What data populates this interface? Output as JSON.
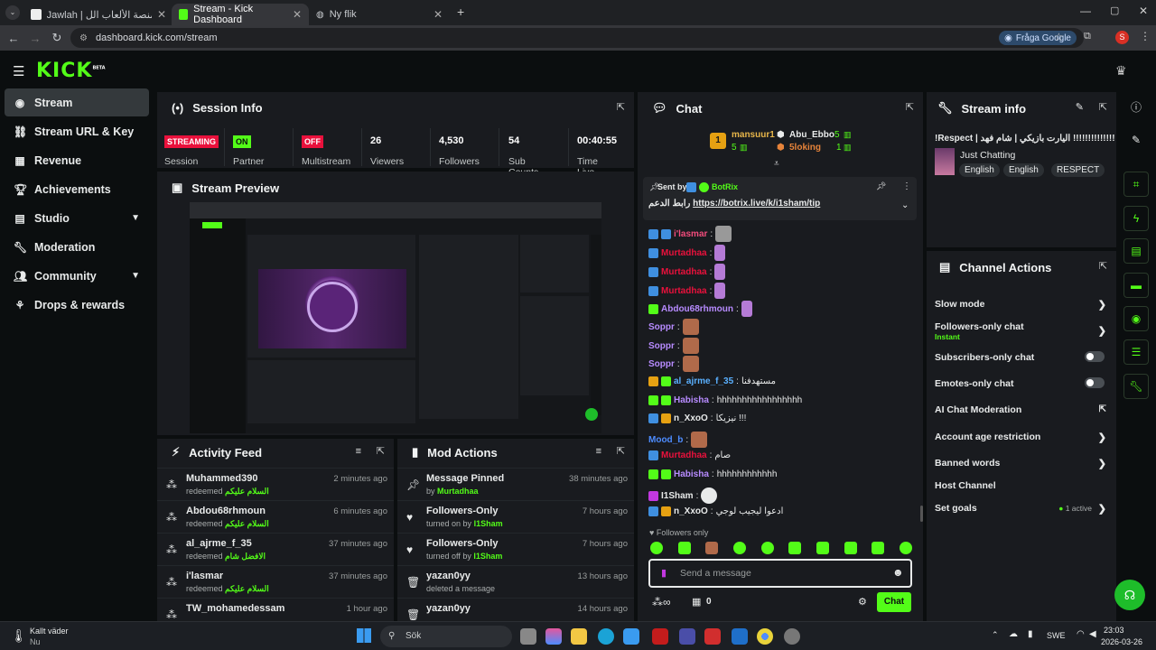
{
  "browser": {
    "tabs": [
      {
        "label": "Jawlah | جولة - منصة الألعاب الل"
      },
      {
        "label": "Stream - Kick Dashboard"
      },
      {
        "label": "Ny flik"
      }
    ],
    "url": "dashboard.kick.com/stream",
    "fraga_label": "Fråga Google",
    "profile_letter": "S"
  },
  "header": {
    "logo": "KICK",
    "beta": "BETA"
  },
  "sidebar": {
    "items": [
      {
        "label": "Stream",
        "icon": "stream-icon"
      },
      {
        "label": "Stream URL & Key",
        "icon": "link-icon"
      },
      {
        "label": "Revenue",
        "icon": "revenue-icon"
      },
      {
        "label": "Achievements",
        "icon": "trophy-icon"
      },
      {
        "label": "Studio",
        "icon": "studio-icon"
      },
      {
        "label": "Moderation",
        "icon": "wrench-icon"
      },
      {
        "label": "Community",
        "icon": "community-icon"
      },
      {
        "label": "Drops & rewards",
        "icon": "drops-icon"
      }
    ]
  },
  "session": {
    "title": "Session Info",
    "stats": [
      {
        "badge": "STREAMING",
        "label": "Session",
        "color": "#e9113c"
      },
      {
        "badge": "ON",
        "label": "Partner",
        "color": "#53fc18"
      },
      {
        "badge": "OFF",
        "label": "Multistream",
        "color": "#e9113c"
      },
      {
        "value": "26",
        "label": "Viewers"
      },
      {
        "value": "4,530",
        "label": "Followers"
      },
      {
        "value": "54",
        "label": "Sub Counts"
      },
      {
        "value": "00:40:55",
        "label": "Time Live"
      }
    ]
  },
  "preview": {
    "title": "Stream Preview"
  },
  "activity": {
    "title": "Activity Feed",
    "rows": [
      {
        "name": "Muhammed390",
        "sub": "redeemed",
        "reward": "السلام عليكم",
        "time": "2 minutes ago"
      },
      {
        "name": "Abdou68rhmoun",
        "sub": "redeemed",
        "reward": "السلام عليكم",
        "time": "6 minutes ago"
      },
      {
        "name": "al_ajrme_f_35",
        "sub": "redeemed",
        "reward": "الافضل شام",
        "time": "37 minutes ago"
      },
      {
        "name": "i'lasmar",
        "sub": "redeemed",
        "reward": "السلام عليكم",
        "time": "37 minutes ago"
      },
      {
        "name": "TW_mohamedessam",
        "sub": "",
        "reward": "",
        "time": "1 hour ago"
      }
    ]
  },
  "mod": {
    "title": "Mod Actions",
    "rows": [
      {
        "name": "Message Pinned",
        "sub": "by",
        "who": "Murtadhaa",
        "time": "38 minutes ago"
      },
      {
        "name": "Followers-Only",
        "sub": "turned on by",
        "who": "I1Sham",
        "time": "7 hours ago"
      },
      {
        "name": "Followers-Only",
        "sub": "turned off by",
        "who": "I1Sham",
        "time": "7 hours ago"
      },
      {
        "name": "yazan0yy",
        "sub": "deleted a message",
        "who": "",
        "time": "13 hours ago"
      },
      {
        "name": "yazan0yy",
        "sub": "",
        "who": "",
        "time": "14 hours ago"
      }
    ]
  },
  "chat": {
    "title": "Chat",
    "gifters": [
      {
        "rank": "1",
        "name": "mansuur1",
        "count": "5"
      },
      {
        "name": "Abu_Ebbo",
        "count": "5"
      },
      {
        "name": "5loking",
        "count": "1"
      }
    ],
    "pinned": {
      "sent_by": "Sent by",
      "bot": "BotRix",
      "text": "رابط الدعم",
      "link": "https://botrix.live/k/i1sham/tip"
    },
    "messages": [
      {
        "user": "i'lasmar",
        "color": "#f24c7c",
        "text": ""
      },
      {
        "user": "Murtadhaa",
        "color": "#e9113c",
        "text": ""
      },
      {
        "user": "Murtadhaa",
        "color": "#e9113c",
        "text": ""
      },
      {
        "user": "Murtadhaa",
        "color": "#e9113c",
        "text": ""
      },
      {
        "user": "Abdou68rhmoun",
        "color": "#b78bff",
        "text": ""
      },
      {
        "user": "Soppr",
        "color": "#b78bff",
        "text": ""
      },
      {
        "user": "Soppr",
        "color": "#b78bff",
        "text": ""
      },
      {
        "user": "Soppr",
        "color": "#b78bff",
        "text": ""
      },
      {
        "user": "al_ajrme_f_35",
        "color": "#5ab0ff",
        "text": "مستهدفنا"
      },
      {
        "user": "Habisha",
        "color": "#b78bff",
        "text": "hhhhhhhhhhhhhhhhh"
      },
      {
        "user": "n_XxoO",
        "color": "#e8eaea",
        "text": "نيزيكا !!!"
      },
      {
        "user": "Mood_b",
        "color": "#4d8cff",
        "text": ""
      },
      {
        "user": "Murtadhaa",
        "color": "#e9113c",
        "text": "صام"
      },
      {
        "user": "Habisha",
        "color": "#b78bff",
        "text": "hhhhhhhhhhhh"
      },
      {
        "user": "I1Sham",
        "color": "#e8eaea",
        "text": ""
      },
      {
        "user": "n_XxoO",
        "color": "#e8eaea",
        "text": "ادعوا ليجيب لوجي"
      }
    ],
    "followers_only": "Followers only",
    "placeholder": "Send a message",
    "count": "0",
    "send_label": "Chat"
  },
  "stream_info": {
    "title": "Stream info",
    "stream_title": "!Respect | جبنا!!!!!!!!!!!!!!! اليارت بازيكي | شام فهد",
    "category": "Just Chatting",
    "tags": [
      "English",
      "English",
      "RESPECT"
    ]
  },
  "channel_actions": {
    "title": "Channel Actions",
    "rows": [
      {
        "label": "Slow mode"
      },
      {
        "label": "Followers-only chat",
        "sub": "Instant"
      },
      {
        "label": "Subscribers-only chat"
      },
      {
        "label": "Emotes-only chat"
      },
      {
        "label": "AI Chat Moderation"
      },
      {
        "label": "Account age restriction"
      },
      {
        "label": "Banned words"
      },
      {
        "label": "Host Channel"
      },
      {
        "label": "Set goals",
        "sub": "1 active"
      }
    ]
  },
  "taskbar": {
    "weather": "Kallt väder",
    "weather_sub": "Nu",
    "search": "Sök",
    "lang": "SWE",
    "time": "23:03",
    "date": "2026-03-26"
  },
  "colors": {
    "accent": "#53fc18",
    "panel": "#191b1f",
    "bg": "#0b0e0f"
  }
}
